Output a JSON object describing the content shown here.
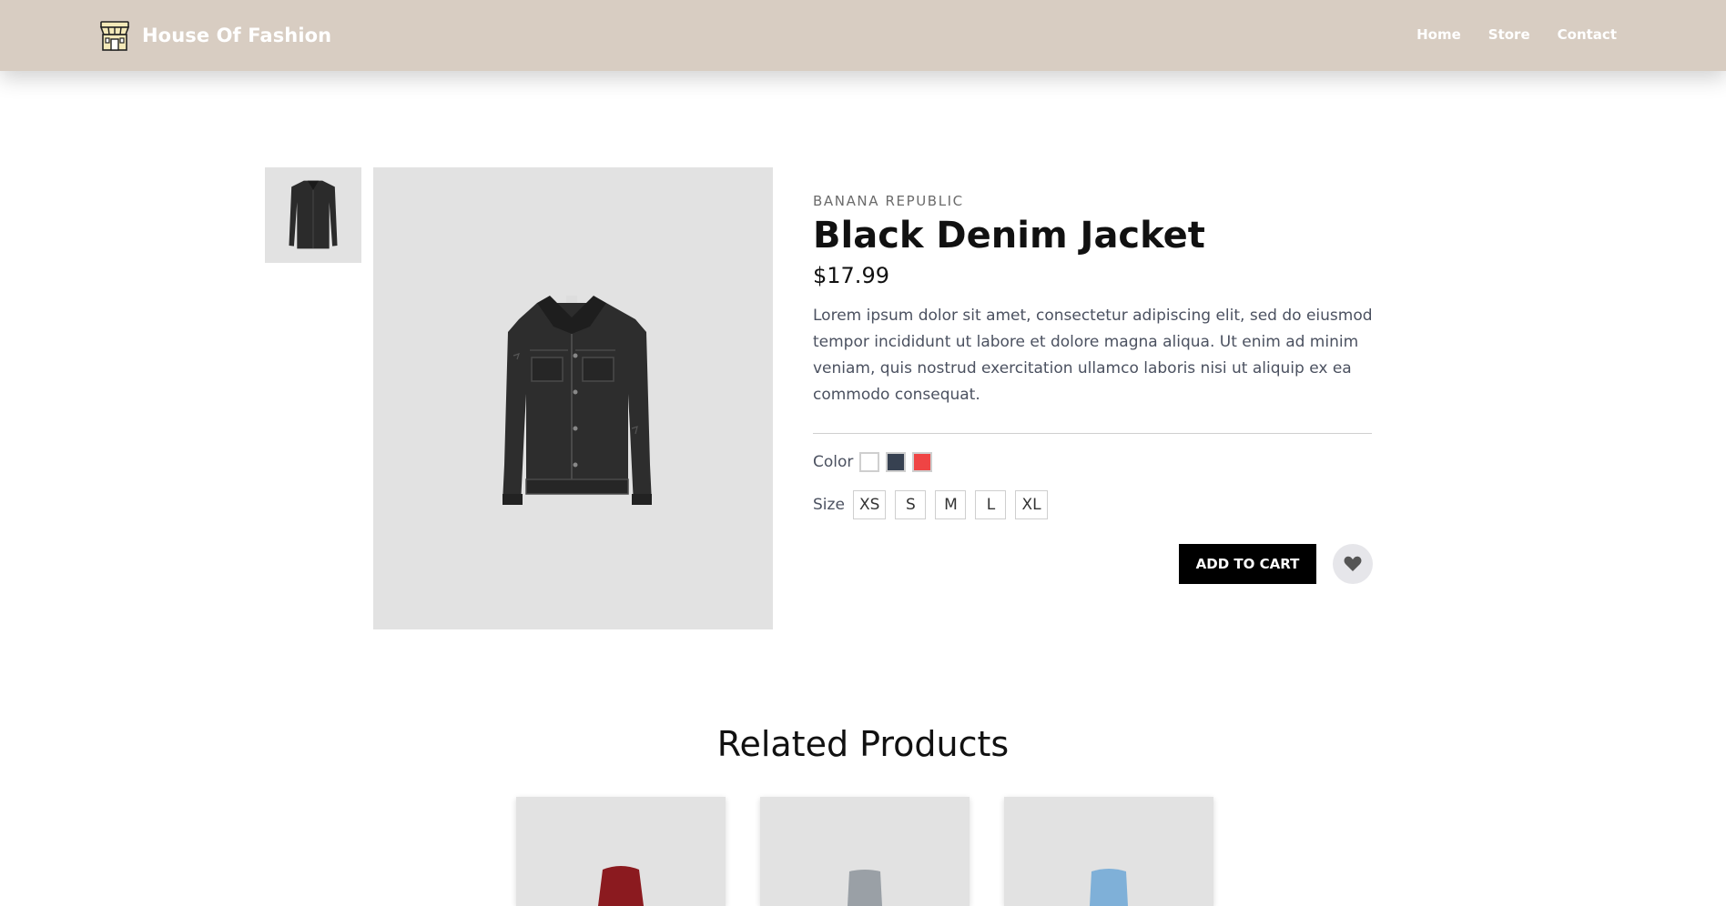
{
  "header": {
    "brand_title": "House Of Fashion",
    "brand_icon": "storefront-icon",
    "nav": [
      {
        "label": "Home"
      },
      {
        "label": "Store"
      },
      {
        "label": "Contact"
      }
    ],
    "background": "#d8cdc2"
  },
  "product": {
    "brand": "BANANA REPUBLIC",
    "title": "Black Denim Jacket",
    "price": "$17.99",
    "description": "Lorem ipsum dolor sit amet, consectetur adipiscing elit, sed do eiusmod tempor incididunt ut labore et dolore magna aliqua. Ut enim ad minim veniam, quis nostrud exercitation ullamco laboris nisi ut aliquip ex ea commodo consequat.",
    "color_label": "Color",
    "colors": [
      "#ffffff",
      "#374151",
      "#ef4444"
    ],
    "size_label": "Size",
    "sizes": [
      "XS",
      "S",
      "M",
      "L",
      "XL"
    ],
    "add_to_cart": "ADD TO CART",
    "wishlist_icon": "heart-icon"
  },
  "related": {
    "title": "Related Products",
    "cards": [
      {
        "image": "red-item-image"
      },
      {
        "image": "grey-item-image"
      },
      {
        "image": "blue-item-image"
      }
    ]
  }
}
